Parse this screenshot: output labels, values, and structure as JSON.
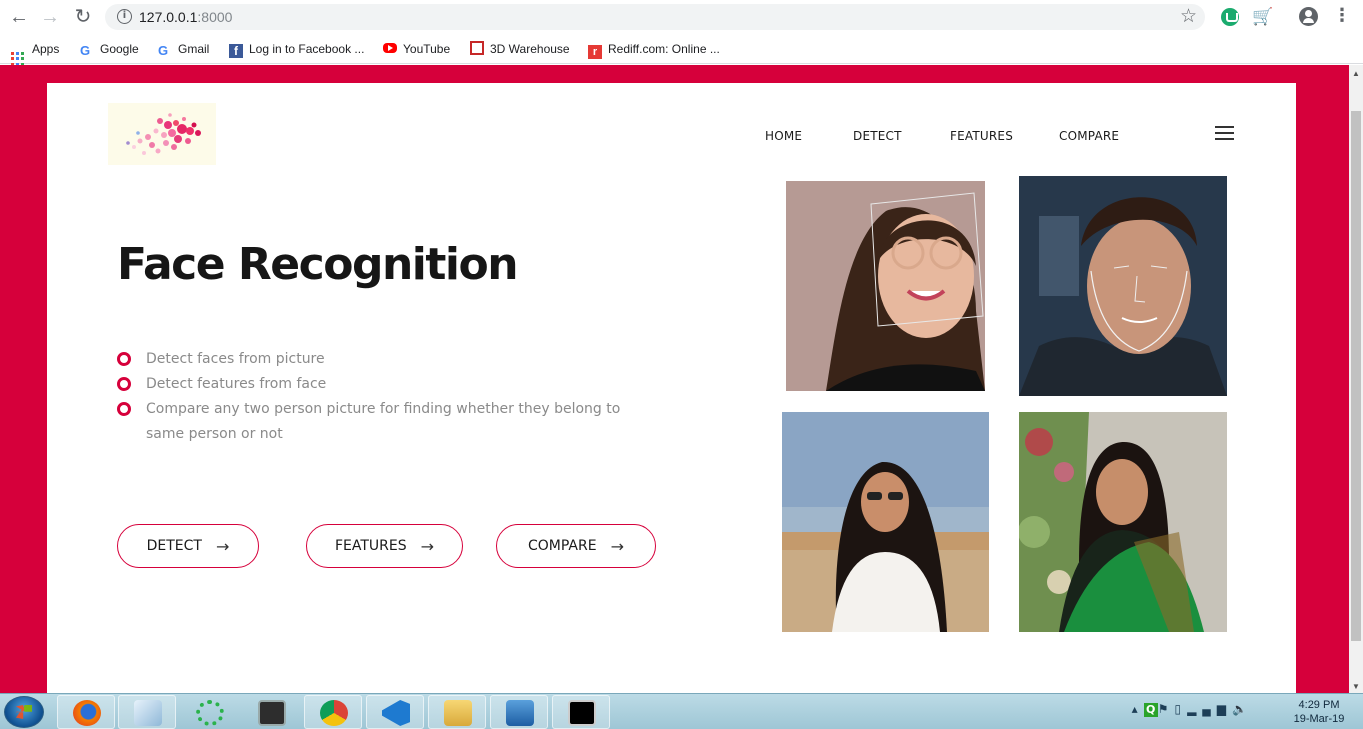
{
  "browser": {
    "url_host": "127.0.0.1",
    "url_port": ":8000",
    "bookmarks": [
      {
        "label": "Apps"
      },
      {
        "label": "Google"
      },
      {
        "label": "Gmail"
      },
      {
        "label": "Log in to Facebook ..."
      },
      {
        "label": "YouTube"
      },
      {
        "label": "3D Warehouse"
      },
      {
        "label": "Rediff.com: Online ..."
      }
    ]
  },
  "nav": {
    "items": [
      "HOME",
      "DETECT",
      "FEATURES",
      "COMPARE"
    ]
  },
  "hero": {
    "title": "Face Recognition",
    "features": [
      "Detect faces from picture",
      "Detect features from face",
      "Compare any two person picture for finding whether they belong to same person or not"
    ],
    "buttons": [
      "DETECT",
      "FEATURES",
      "COMPARE"
    ]
  },
  "colors": {
    "accent": "#d6003b",
    "text_dark": "#161616",
    "text_muted": "#8a8a8a"
  },
  "icons": {
    "arrow": "→",
    "star": "☆",
    "menu": "⋮"
  },
  "taskbar": {
    "time": "4:29 PM",
    "date": "19-Mar-19"
  }
}
